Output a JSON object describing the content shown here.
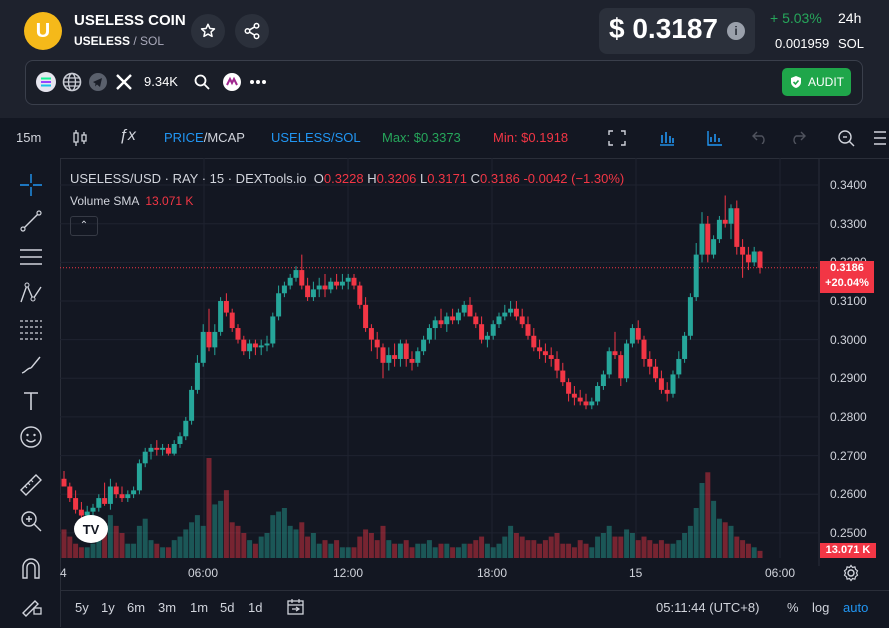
{
  "header": {
    "coin_name": "USELESS COIN",
    "symbol": "USELESS",
    "quote_sep": " / SOL",
    "price": "$ 0.3187",
    "change": "+ 5.03%",
    "change_period": "24h",
    "sol_price": "0.001959",
    "sol_unit": "SOL",
    "followers": "9.34K",
    "audit_label": "AUDIT"
  },
  "toolbar": {
    "interval": "15m",
    "price_label": "PRICE",
    "mcap_label": "/MCAP",
    "pair_label": "USELESS/SOL",
    "max_label": "Max: $0.3373",
    "min_label": "Min: $0.1918"
  },
  "legend": {
    "title": "USELESS/USD · RAY · 15 · DEXTools.io",
    "o_key": "O",
    "o_val": "0.3228",
    "h_key": "H",
    "h_val": "0.3206",
    "l_key": "L",
    "l_val": "0.3171",
    "c_key": "C",
    "c_val": "0.3186",
    "change": "-0.0042 (−1.30%)",
    "volume_label": "Volume SMA",
    "volume_val": "13.071 K",
    "collapse": "⌃"
  },
  "price_axis": {
    "ticks": [
      "0.3400",
      "0.3300",
      "0.3200",
      "0.3100",
      "0.3000",
      "0.2900",
      "0.2800",
      "0.2700",
      "0.2600",
      "0.2500"
    ],
    "last_price": "0.3186",
    "last_change": "+20.04%",
    "volume_tag": "13.071 K"
  },
  "time_axis": {
    "ticks": [
      "4",
      "06:00",
      "12:00",
      "18:00",
      "15",
      "06:00"
    ]
  },
  "bottombar": {
    "ranges": [
      "5y",
      "1y",
      "6m",
      "3m",
      "1m",
      "5d",
      "1d"
    ],
    "clock": "05:11:44 (UTC+8)",
    "pct": "%",
    "log": "log",
    "auto": "auto"
  },
  "colors": {
    "up": "#26a69a",
    "down": "#f23645",
    "accent": "#2196f3",
    "max": "#26a65b"
  },
  "chart_data": {
    "type": "candlestick",
    "ylim": [
      0.2435,
      0.347
    ],
    "candles": [
      [
        0.264,
        0.266,
        0.262,
        0.262
      ],
      [
        0.262,
        0.263,
        0.258,
        0.259
      ],
      [
        0.259,
        0.261,
        0.255,
        0.256
      ],
      [
        0.256,
        0.258,
        0.253,
        0.2545
      ],
      [
        0.2545,
        0.257,
        0.252,
        0.2555
      ],
      [
        0.2555,
        0.2575,
        0.2535,
        0.2565
      ],
      [
        0.2565,
        0.26,
        0.2555,
        0.259
      ],
      [
        0.259,
        0.263,
        0.257,
        0.2575
      ],
      [
        0.2575,
        0.264,
        0.256,
        0.262
      ],
      [
        0.262,
        0.263,
        0.259,
        0.26
      ],
      [
        0.26,
        0.262,
        0.258,
        0.259
      ],
      [
        0.259,
        0.261,
        0.258,
        0.26
      ],
      [
        0.26,
        0.262,
        0.259,
        0.261
      ],
      [
        0.261,
        0.269,
        0.26,
        0.268
      ],
      [
        0.268,
        0.272,
        0.267,
        0.271
      ],
      [
        0.271,
        0.273,
        0.269,
        0.272
      ],
      [
        0.272,
        0.274,
        0.27,
        0.2715
      ],
      [
        0.2715,
        0.273,
        0.27,
        0.272
      ],
      [
        0.272,
        0.273,
        0.27,
        0.2705
      ],
      [
        0.2705,
        0.274,
        0.27,
        0.273
      ],
      [
        0.273,
        0.276,
        0.272,
        0.275
      ],
      [
        0.275,
        0.28,
        0.274,
        0.279
      ],
      [
        0.279,
        0.288,
        0.278,
        0.287
      ],
      [
        0.287,
        0.296,
        0.286,
        0.294
      ],
      [
        0.294,
        0.304,
        0.293,
        0.302
      ],
      [
        0.302,
        0.308,
        0.297,
        0.298
      ],
      [
        0.298,
        0.304,
        0.296,
        0.302
      ],
      [
        0.302,
        0.311,
        0.301,
        0.31
      ],
      [
        0.31,
        0.312,
        0.306,
        0.307
      ],
      [
        0.307,
        0.308,
        0.302,
        0.303
      ],
      [
        0.303,
        0.304,
        0.299,
        0.3
      ],
      [
        0.3,
        0.301,
        0.296,
        0.297
      ],
      [
        0.297,
        0.3,
        0.295,
        0.299
      ],
      [
        0.299,
        0.3,
        0.296,
        0.298
      ],
      [
        0.298,
        0.3,
        0.296,
        0.2985
      ],
      [
        0.2985,
        0.301,
        0.297,
        0.299
      ],
      [
        0.299,
        0.307,
        0.298,
        0.306
      ],
      [
        0.306,
        0.314,
        0.305,
        0.312
      ],
      [
        0.312,
        0.315,
        0.311,
        0.314
      ],
      [
        0.314,
        0.317,
        0.313,
        0.316
      ],
      [
        0.316,
        0.319,
        0.315,
        0.318
      ],
      [
        0.318,
        0.322,
        0.313,
        0.314
      ],
      [
        0.314,
        0.316,
        0.31,
        0.311
      ],
      [
        0.311,
        0.315,
        0.31,
        0.313
      ],
      [
        0.313,
        0.316,
        0.311,
        0.314
      ],
      [
        0.314,
        0.317,
        0.311,
        0.313
      ],
      [
        0.313,
        0.316,
        0.312,
        0.315
      ],
      [
        0.315,
        0.317,
        0.313,
        0.314
      ],
      [
        0.314,
        0.317,
        0.313,
        0.315
      ],
      [
        0.315,
        0.317,
        0.313,
        0.316
      ],
      [
        0.316,
        0.317,
        0.313,
        0.314
      ],
      [
        0.314,
        0.315,
        0.308,
        0.309
      ],
      [
        0.309,
        0.311,
        0.302,
        0.303
      ],
      [
        0.303,
        0.304,
        0.297,
        0.3
      ],
      [
        0.3,
        0.302,
        0.295,
        0.298
      ],
      [
        0.298,
        0.299,
        0.29,
        0.294
      ],
      [
        0.294,
        0.298,
        0.292,
        0.296
      ],
      [
        0.296,
        0.299,
        0.293,
        0.295
      ],
      [
        0.295,
        0.3,
        0.293,
        0.299
      ],
      [
        0.299,
        0.3,
        0.293,
        0.295
      ],
      [
        0.295,
        0.297,
        0.292,
        0.294
      ],
      [
        0.294,
        0.298,
        0.293,
        0.297
      ],
      [
        0.297,
        0.301,
        0.296,
        0.3
      ],
      [
        0.3,
        0.304,
        0.299,
        0.303
      ],
      [
        0.303,
        0.306,
        0.3,
        0.305
      ],
      [
        0.305,
        0.308,
        0.303,
        0.304
      ],
      [
        0.304,
        0.307,
        0.302,
        0.306
      ],
      [
        0.306,
        0.308,
        0.304,
        0.305
      ],
      [
        0.305,
        0.308,
        0.304,
        0.307
      ],
      [
        0.307,
        0.31,
        0.306,
        0.309
      ],
      [
        0.309,
        0.311,
        0.307,
        0.306
      ],
      [
        0.306,
        0.307,
        0.303,
        0.304
      ],
      [
        0.304,
        0.306,
        0.299,
        0.3
      ],
      [
        0.3,
        0.302,
        0.298,
        0.301
      ],
      [
        0.301,
        0.305,
        0.3,
        0.304
      ],
      [
        0.304,
        0.307,
        0.303,
        0.306
      ],
      [
        0.306,
        0.309,
        0.305,
        0.307
      ],
      [
        0.307,
        0.31,
        0.306,
        0.308
      ],
      [
        0.308,
        0.31,
        0.305,
        0.306
      ],
      [
        0.306,
        0.308,
        0.303,
        0.304
      ],
      [
        0.304,
        0.306,
        0.3,
        0.301
      ],
      [
        0.301,
        0.303,
        0.297,
        0.298
      ],
      [
        0.298,
        0.3,
        0.295,
        0.297
      ],
      [
        0.297,
        0.299,
        0.294,
        0.296
      ],
      [
        0.296,
        0.298,
        0.293,
        0.295
      ],
      [
        0.295,
        0.297,
        0.29,
        0.292
      ],
      [
        0.292,
        0.294,
        0.288,
        0.289
      ],
      [
        0.289,
        0.29,
        0.284,
        0.286
      ],
      [
        0.286,
        0.288,
        0.283,
        0.285
      ],
      [
        0.285,
        0.287,
        0.283,
        0.284
      ],
      [
        0.284,
        0.286,
        0.282,
        0.283
      ],
      [
        0.283,
        0.285,
        0.282,
        0.284
      ],
      [
        0.284,
        0.289,
        0.283,
        0.288
      ],
      [
        0.288,
        0.292,
        0.287,
        0.291
      ],
      [
        0.291,
        0.298,
        0.29,
        0.297
      ],
      [
        0.297,
        0.302,
        0.295,
        0.296
      ],
      [
        0.296,
        0.297,
        0.288,
        0.29
      ],
      [
        0.29,
        0.3,
        0.289,
        0.299
      ],
      [
        0.299,
        0.304,
        0.298,
        0.303
      ],
      [
        0.303,
        0.305,
        0.299,
        0.3
      ],
      [
        0.3,
        0.301,
        0.293,
        0.295
      ],
      [
        0.295,
        0.297,
        0.291,
        0.293
      ],
      [
        0.293,
        0.295,
        0.289,
        0.29
      ],
      [
        0.29,
        0.292,
        0.286,
        0.287
      ],
      [
        0.287,
        0.289,
        0.284,
        0.286
      ],
      [
        0.286,
        0.292,
        0.285,
        0.291
      ],
      [
        0.291,
        0.297,
        0.29,
        0.295
      ],
      [
        0.295,
        0.302,
        0.294,
        0.301
      ],
      [
        0.301,
        0.312,
        0.3,
        0.311
      ],
      [
        0.311,
        0.325,
        0.31,
        0.322
      ],
      [
        0.322,
        0.333,
        0.32,
        0.33
      ],
      [
        0.33,
        0.332,
        0.32,
        0.322
      ],
      [
        0.322,
        0.327,
        0.321,
        0.326
      ],
      [
        0.326,
        0.332,
        0.325,
        0.331
      ],
      [
        0.331,
        0.3373,
        0.329,
        0.33
      ],
      [
        0.33,
        0.335,
        0.326,
        0.334
      ],
      [
        0.334,
        0.336,
        0.322,
        0.324
      ],
      [
        0.324,
        0.326,
        0.316,
        0.322
      ],
      [
        0.322,
        0.324,
        0.318,
        0.32
      ],
      [
        0.32,
        0.324,
        0.319,
        0.3228
      ],
      [
        0.3228,
        0.323,
        0.3171,
        0.3186
      ]
    ],
    "volumes": [
      0.8,
      0.6,
      0.4,
      0.3,
      0.3,
      0.4,
      0.6,
      0.8,
      1.2,
      0.9,
      0.7,
      0.4,
      0.4,
      0.9,
      1.1,
      0.5,
      0.4,
      0.3,
      0.3,
      0.5,
      0.6,
      0.8,
      1.0,
      1.2,
      0.9,
      2.8,
      1.5,
      1.6,
      1.9,
      1.0,
      0.9,
      0.7,
      0.5,
      0.4,
      0.6,
      0.7,
      1.2,
      1.3,
      1.4,
      0.9,
      0.8,
      1.0,
      0.6,
      0.7,
      0.4,
      0.5,
      0.4,
      0.5,
      0.3,
      0.3,
      0.3,
      0.6,
      0.8,
      0.7,
      0.5,
      0.9,
      0.5,
      0.4,
      0.4,
      0.5,
      0.3,
      0.4,
      0.4,
      0.5,
      0.3,
      0.4,
      0.4,
      0.3,
      0.3,
      0.4,
      0.4,
      0.5,
      0.6,
      0.4,
      0.3,
      0.4,
      0.6,
      0.9,
      0.7,
      0.6,
      0.5,
      0.5,
      0.4,
      0.5,
      0.6,
      0.7,
      0.4,
      0.4,
      0.3,
      0.5,
      0.4,
      0.3,
      0.6,
      0.7,
      0.9,
      0.6,
      0.6,
      0.8,
      0.7,
      0.5,
      0.6,
      0.5,
      0.4,
      0.5,
      0.4,
      0.4,
      0.5,
      0.7,
      0.9,
      1.4,
      2.1,
      2.4,
      1.6,
      1.1,
      1.0,
      0.9,
      0.6,
      0.5,
      0.4,
      0.3,
      0.2
    ]
  }
}
